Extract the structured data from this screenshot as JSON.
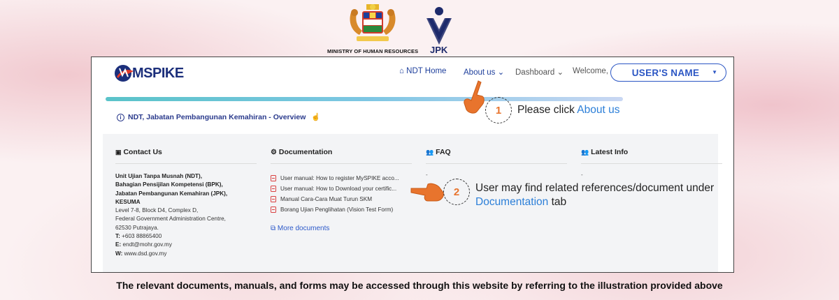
{
  "header": {
    "ministry_label": "MINISTRY OF HUMAN RESOURCES",
    "agency_label": "JPK"
  },
  "app": {
    "brand": "MSPIKE"
  },
  "nav": {
    "home": "NDT Home",
    "about": "About us",
    "dashboard": "Dashboard",
    "welcome": "Welcome,",
    "user_name": "USER'S NAME"
  },
  "page": {
    "overview_title": "NDT, Jabatan Pembangunan Kemahiran - Overview"
  },
  "sections": {
    "contact": {
      "title": "Contact Us",
      "lines": [
        "Unit Ujian Tanpa Musnah (NDT),",
        "Bahagian Pensijilan Kompetensi (BPK),",
        "Jabatan Pembangunan Kemahiran (JPK),",
        "KESUMA",
        "Level 7-8, Block D4, Complex D,",
        "Federal Government Administration Centre,",
        "62530 Putrajaya.",
        "+603 88865400",
        "endt@mohr.gov.my",
        "www.dsd.gov.my"
      ],
      "phone_label": "T:",
      "email_label": "E:",
      "web_label": "W:"
    },
    "documentation": {
      "title": "Documentation",
      "items": [
        "User manual: How to register MySPIKE acco...",
        "User manual: How to Download your certific...",
        "Manual Cara-Cara Muat Turun SKM",
        "Borang Ujian Penglihatan (Vision Test Form)"
      ],
      "more": "More documents"
    },
    "faq": {
      "title": "FAQ",
      "placeholder": "-"
    },
    "latest": {
      "title": "Latest Info",
      "placeholder": "-"
    }
  },
  "callouts": [
    {
      "number": "1",
      "text_before": "Please click ",
      "highlight": "About us",
      "text_after": ""
    },
    {
      "number": "2",
      "text_before": "User may find related references/document under",
      "highlight": "Documentation",
      "text_after": " tab"
    }
  ],
  "footer": {
    "caption": "The relevant documents, manuals, and forms may be accessed through this website by referring to the illustration provided above"
  },
  "colors": {
    "brand_navy": "#1c2f7b",
    "link_blue": "#2c59c9",
    "accent_orange": "#e8742d",
    "pdf_red": "#d94040"
  }
}
